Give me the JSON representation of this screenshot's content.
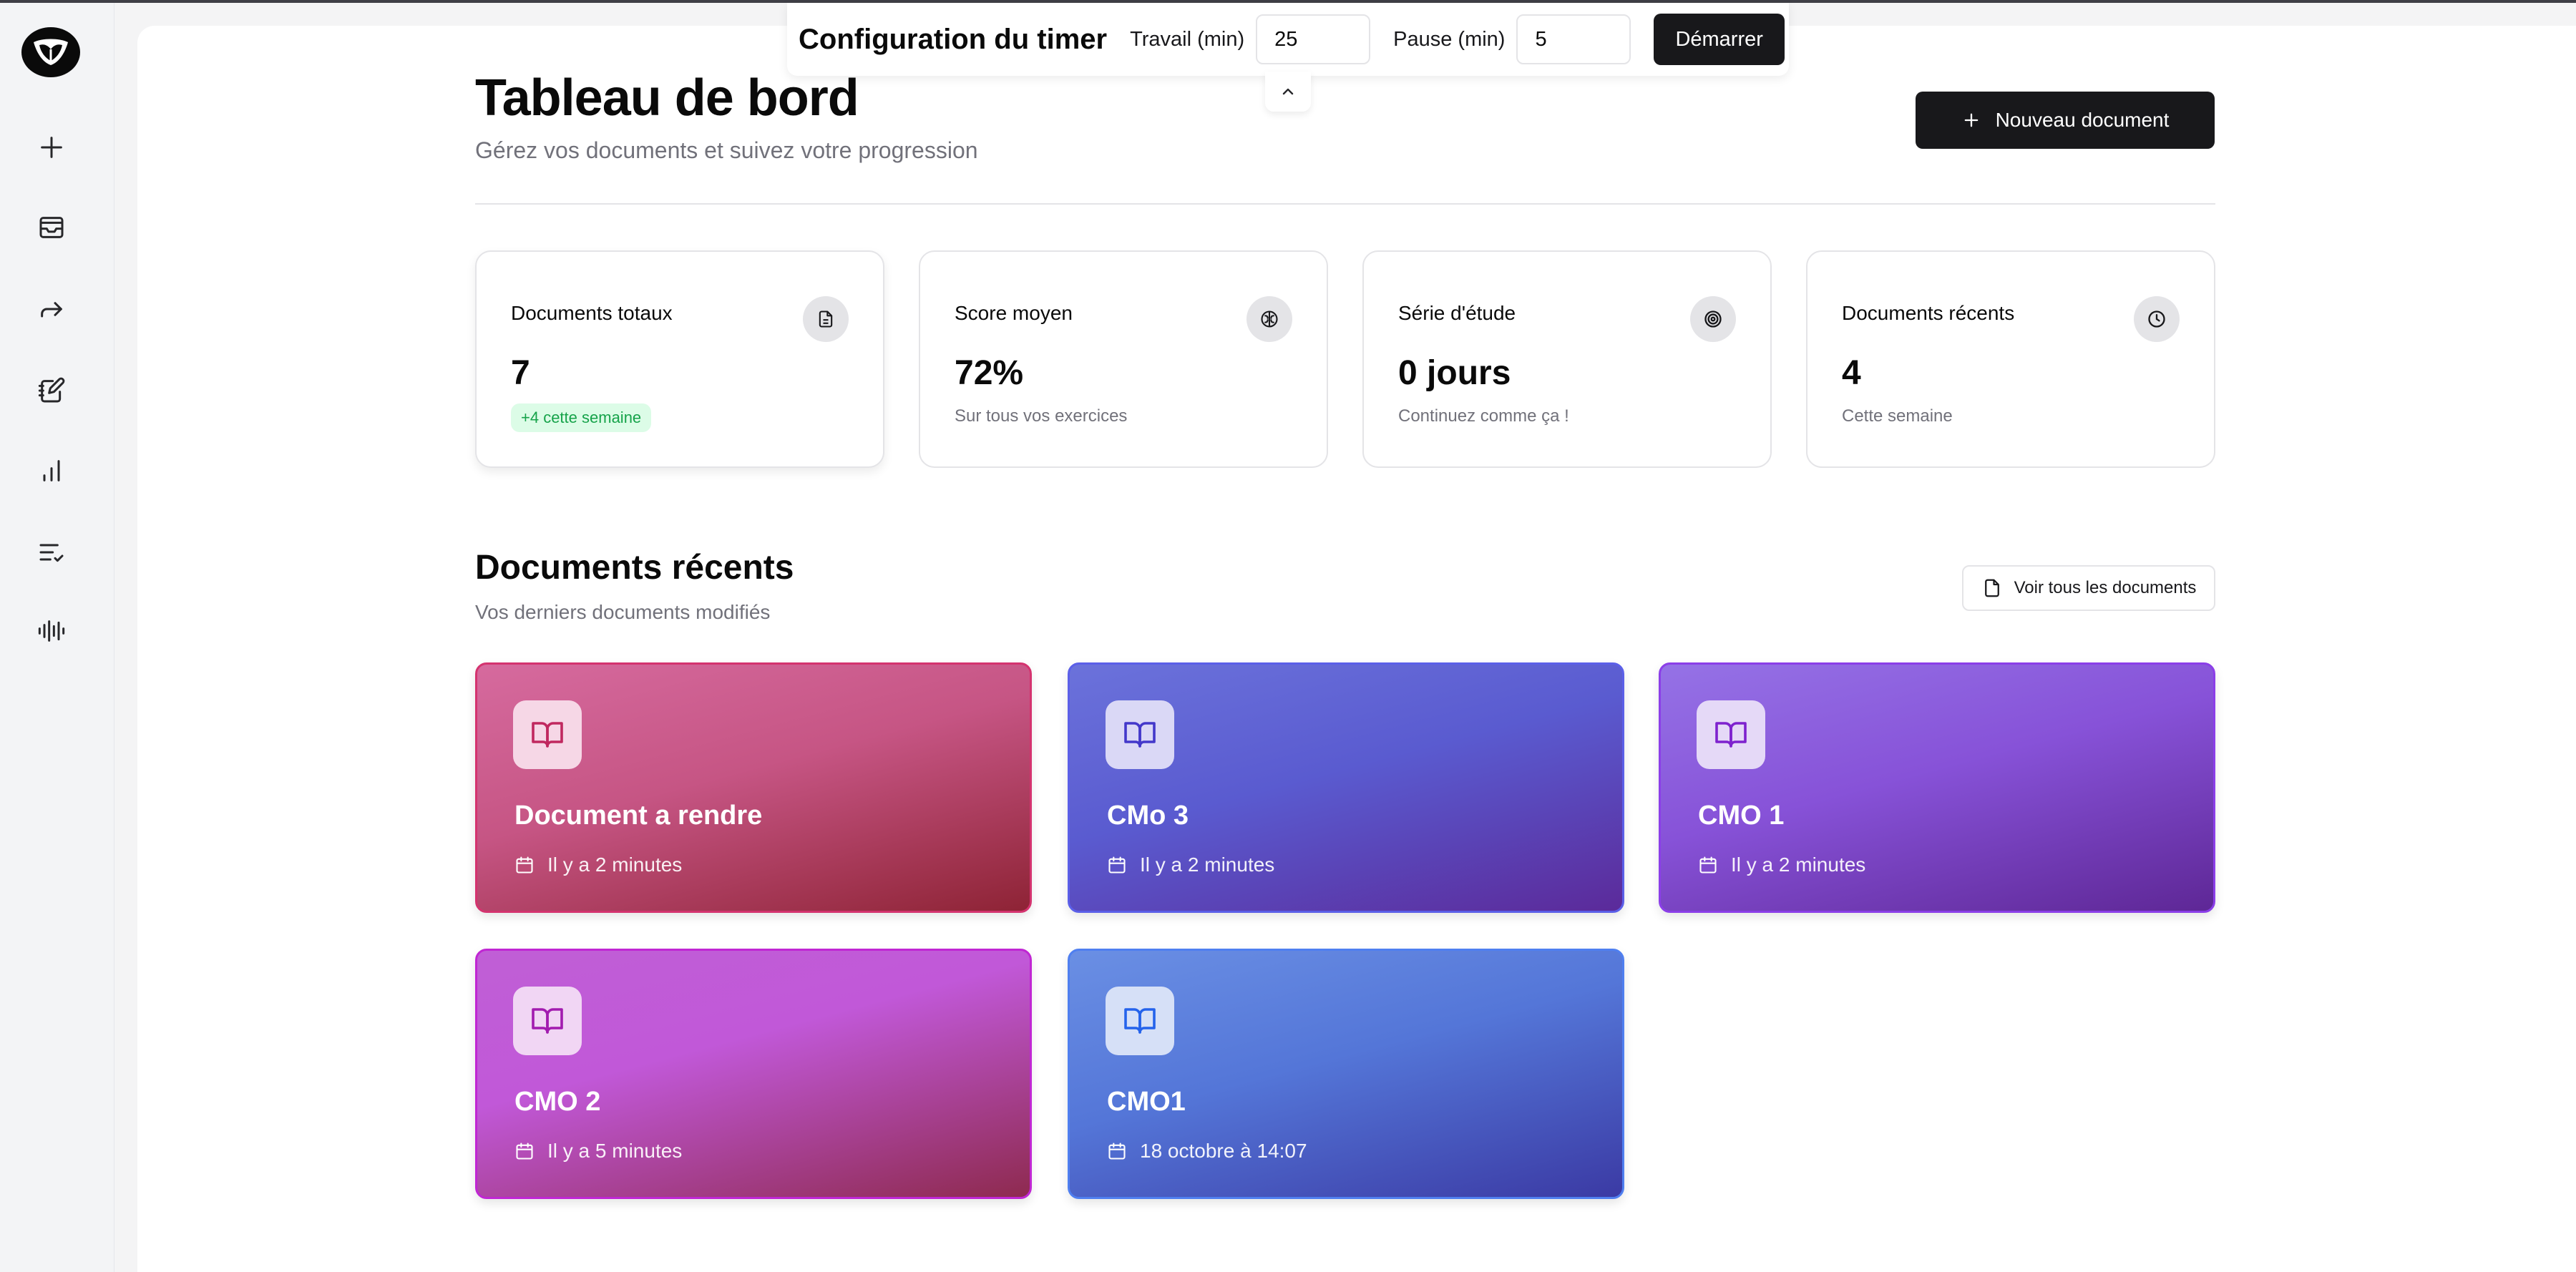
{
  "timer": {
    "title": "Configuration du timer",
    "work_label": "Travail (min)",
    "work_value": "25",
    "pause_label": "Pause (min)",
    "pause_value": "5",
    "start_label": "Démarrer"
  },
  "sidebar": {
    "items": [
      {
        "icon": "plus-icon"
      },
      {
        "icon": "inbox-icon"
      },
      {
        "icon": "forward-arrow-icon"
      },
      {
        "icon": "notebook-edit-icon"
      },
      {
        "icon": "bar-chart-icon"
      },
      {
        "icon": "list-check-icon"
      },
      {
        "icon": "audio-waveform-icon"
      }
    ]
  },
  "header": {
    "title": "Tableau de bord",
    "subtitle": "Gérez vos documents et suivez votre progression",
    "new_document_label": "Nouveau document"
  },
  "stats": [
    {
      "title": "Documents totaux",
      "value": "7",
      "badge": "+4 cette semaine",
      "icon": "file-text-icon"
    },
    {
      "title": "Score moyen",
      "value": "72%",
      "note": "Sur tous vos exercices",
      "icon": "brain-icon"
    },
    {
      "title": "Série d'étude",
      "value": "0 jours",
      "note": "Continuez comme ça !",
      "icon": "target-icon"
    },
    {
      "title": "Documents récents",
      "value": "4",
      "note": "Cette semaine",
      "icon": "clock-icon"
    }
  ],
  "recent": {
    "title": "Documents récents",
    "subtitle": "Vos derniers documents modifiés",
    "view_all_label": "Voir tous les documents",
    "documents": [
      {
        "title": "Document a rendre",
        "date": "Il y a 2 minutes"
      },
      {
        "title": "CMo 3",
        "date": "Il y a 2 minutes"
      },
      {
        "title": "CMO 1",
        "date": "Il y a 2 minutes"
      },
      {
        "title": "CMO 2",
        "date": "Il y a 5 minutes"
      },
      {
        "title": "CMO1",
        "date": "18 octobre à 14:07"
      }
    ]
  },
  "colors": {
    "primary": "#18181b",
    "card_pink": "#d0598d",
    "card_indigo": "#5d5fd6",
    "card_violet": "#8a53d8",
    "card_magenta": "#c255d4",
    "card_blue": "#5a7fe0",
    "badge_green": "#16a34a"
  }
}
